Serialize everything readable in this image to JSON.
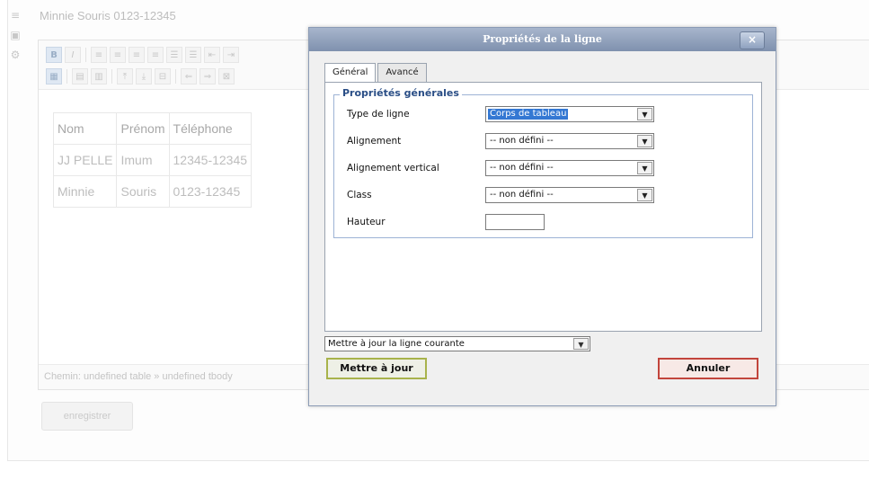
{
  "background": {
    "header_text": "Minnie Souris   0123-12345",
    "table": {
      "headers": [
        "Nom",
        "Prénom",
        "Téléphone"
      ],
      "rows": [
        [
          "JJ PELLE",
          "Imum",
          "12345-12345"
        ],
        [
          "Minnie",
          "Souris",
          "0123-12345"
        ]
      ]
    },
    "path": "Chemin: undefined table » undefined tbody",
    "save_label": "enregistrer"
  },
  "dialog": {
    "title": "Propriétés de la ligne",
    "close_label": "×",
    "tabs": [
      {
        "label": "Général",
        "selected": true
      },
      {
        "label": "Avancé",
        "selected": false
      }
    ],
    "legend": "Propriétés générales",
    "fields": {
      "type": {
        "label": "Type de ligne",
        "value": "Corps de tableau"
      },
      "align": {
        "label": "Alignement",
        "value": "-- non défini --"
      },
      "valign": {
        "label": "Alignement vertical",
        "value": "-- non défini --"
      },
      "class": {
        "label": "Class",
        "value": "-- non défini --"
      },
      "height": {
        "label": "Hauteur",
        "value": ""
      }
    },
    "action_select": "Mettre à jour la ligne courante",
    "update_label": "Mettre à jour",
    "cancel_label": "Annuler"
  },
  "colors": {
    "title_bar": "#8c9db8",
    "legend_text": "#2a4e86",
    "highlight": "#3478d3",
    "update_border": "#a8b34b",
    "cancel_border": "#c2453c"
  }
}
